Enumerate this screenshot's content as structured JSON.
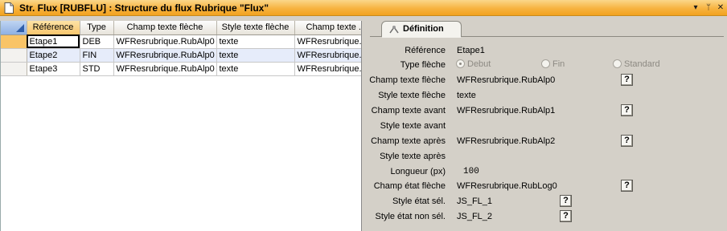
{
  "window": {
    "title": "Str. Flux  [RUBFLU] : Structure du flux Rubrique \"Flux\"",
    "buttons": [
      "▾",
      "ᛘ",
      "✕"
    ]
  },
  "grid": {
    "columns": [
      "Référence",
      "Type",
      "Champ texte flèche",
      "Style texte flèche",
      "Champ texte ..."
    ],
    "rows": [
      {
        "reference": "Etape1",
        "type": "DEB",
        "champ": "WFResrubrique.RubAlp0",
        "style": "texte",
        "champ2": "WFResrubrique.R"
      },
      {
        "reference": "Etape2",
        "type": "FIN",
        "champ": "WFResrubrique.RubAlp0",
        "style": "texte",
        "champ2": "WFResrubrique.R"
      },
      {
        "reference": "Etape3",
        "type": "STD",
        "champ": "WFResrubrique.RubAlp0",
        "style": "texte",
        "champ2": "WFResrubrique.R"
      }
    ]
  },
  "definition": {
    "tab_label": "Définition",
    "help_label": "?",
    "fields": {
      "reference": {
        "label": "Référence",
        "value": "Etape1"
      },
      "type_fleche": {
        "label": "Type flèche",
        "options": [
          "Debut",
          "Fin",
          "Standard"
        ],
        "selected": "Debut"
      },
      "champ_texte_fleche": {
        "label": "Champ texte flèche",
        "value": "WFResrubrique.RubAlp0"
      },
      "style_texte_fleche": {
        "label": "Style texte flèche",
        "value": "texte"
      },
      "champ_texte_avant": {
        "label": "Champ texte avant",
        "value": "WFResrubrique.RubAlp1"
      },
      "style_texte_avant": {
        "label": "Style texte avant",
        "value": ""
      },
      "champ_texte_apres": {
        "label": "Champ texte après",
        "value": "WFResrubrique.RubAlp2"
      },
      "style_texte_apres": {
        "label": "Style texte après",
        "value": ""
      },
      "longueur": {
        "label": "Longueur (px)",
        "value": "100"
      },
      "champ_etat_fleche": {
        "label": "Champ état flèche",
        "value": "WFResrubrique.RubLog0"
      },
      "style_etat_sel": {
        "label": "Style état sél.",
        "value": "JS_FL_1"
      },
      "style_etat_non_sel": {
        "label": "Style état non sél.",
        "value": "JS_FL_2"
      }
    }
  },
  "colors": {
    "titlebar": "#f7b340",
    "selected_header": "#f8c66d",
    "alt_row": "#e6ecfa"
  }
}
